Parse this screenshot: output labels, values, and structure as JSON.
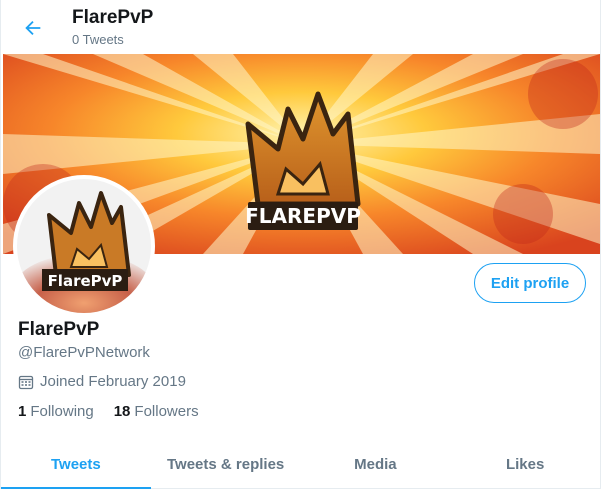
{
  "header": {
    "title": "FlarePvP",
    "tweet_count": "0 Tweets"
  },
  "banner": {
    "logo_text": "FLAREPVP"
  },
  "avatar": {
    "logo_text": "FlarePvP"
  },
  "profile": {
    "edit_label": "Edit profile",
    "name": "FlarePvP",
    "handle": "@FlarePvPNetwork",
    "joined": "Joined February 2019",
    "following_count": "1",
    "following_label": "Following",
    "followers_count": "18",
    "followers_label": "Followers"
  },
  "tabs": [
    {
      "label": "Tweets",
      "active": true
    },
    {
      "label": "Tweets & replies",
      "active": false
    },
    {
      "label": "Media",
      "active": false
    },
    {
      "label": "Likes",
      "active": false
    }
  ],
  "colors": {
    "accent": "#1da1f2",
    "text_primary": "#14171a",
    "text_secondary": "#657786"
  },
  "icons": {
    "back": "back-arrow-icon",
    "calendar": "calendar-icon"
  }
}
